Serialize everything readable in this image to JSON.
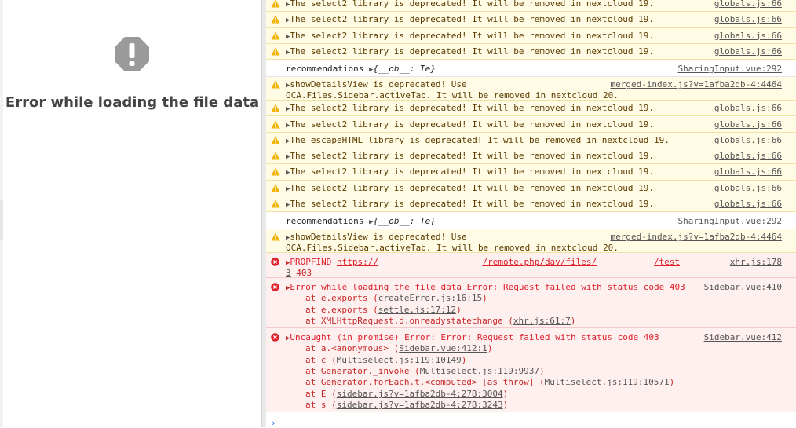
{
  "left": {
    "error_title": "Error while loading the file data"
  },
  "console": {
    "rows": [
      {
        "type": "warn",
        "msg": "The select2 library is deprecated! It will be removed in nextcloud 19.",
        "src": "globals.js:66"
      },
      {
        "type": "warn",
        "msg": "The select2 library is deprecated! It will be removed in nextcloud 19.",
        "src": "globals.js:66"
      },
      {
        "type": "warn",
        "msg": "The select2 library is deprecated! It will be removed in nextcloud 19.",
        "src": "globals.js:66"
      },
      {
        "type": "warn",
        "msg": "The select2 library is deprecated! It will be removed in nextcloud 19.",
        "src": "globals.js:66"
      },
      {
        "type": "log",
        "prefix": "recommendations",
        "obj": "{__ob__: Te}",
        "src": "SharingInput.vue:292"
      },
      {
        "type": "warn",
        "msg": "showDetailsView is deprecated! Use",
        "msg2": "OCA.Files.Sidebar.activeTab. It will be removed in nextcloud 20.",
        "src": "merged-index.js?v=1afba2db-4:4464"
      },
      {
        "type": "warn",
        "msg": "The select2 library is deprecated! It will be removed in nextcloud 19.",
        "src": "globals.js:66"
      },
      {
        "type": "warn",
        "msg": "The select2 library is deprecated! It will be removed in nextcloud 19.",
        "src": "globals.js:66"
      },
      {
        "type": "warn",
        "msg": "The escapeHTML library is deprecated! It will be removed in nextcloud 19.",
        "src": "globals.js:66"
      },
      {
        "type": "warn",
        "msg": "The select2 library is deprecated! It will be removed in nextcloud 19.",
        "src": "globals.js:66"
      },
      {
        "type": "warn",
        "msg": "The select2 library is deprecated! It will be removed in nextcloud 19.",
        "src": "globals.js:66"
      },
      {
        "type": "warn",
        "msg": "The select2 library is deprecated! It will be removed in nextcloud 19.",
        "src": "globals.js:66"
      },
      {
        "type": "warn",
        "msg": "The select2 library is deprecated! It will be removed in nextcloud 19.",
        "src": "globals.js:66"
      },
      {
        "type": "log",
        "prefix": "recommendations",
        "obj": "{__ob__: Te}",
        "src": "SharingInput.vue:292"
      },
      {
        "type": "warn",
        "msg": "showDetailsView is deprecated! Use",
        "msg2": "OCA.Files.Sidebar.activeTab. It will be removed in nextcloud 20.",
        "src": "merged-index.js?v=1afba2db-4:4464"
      }
    ],
    "propfind": {
      "method": "PROPFIND",
      "url_start": "https://",
      "url_mid": "/remote.php/dav/files/",
      "url_end": "/test",
      "src": "xhr.js:178",
      "src_cont": "3",
      "status": "403"
    },
    "error1": {
      "msg": "Error while loading the file data Error: Request failed with status code 403",
      "src": "Sidebar.vue:410",
      "stack": [
        {
          "at": "at e.exports (",
          "link": "createError.js:16:15",
          "end": ")"
        },
        {
          "at": "at e.exports (",
          "link": "settle.js:17:12",
          "end": ")"
        },
        {
          "at": "at XMLHttpRequest.d.onreadystatechange (",
          "link": "xhr.js:61:7",
          "end": ")"
        }
      ]
    },
    "error2": {
      "msg": "Uncaught (in promise) Error: Error: Request failed with status code 403",
      "src": "Sidebar.vue:412",
      "stack": [
        {
          "at": "at a.<anonymous> (",
          "link": "Sidebar.vue:412:1",
          "end": ")"
        },
        {
          "at": "at c (",
          "link": "Multiselect.js:119:10149",
          "end": ")"
        },
        {
          "at": "at Generator._invoke (",
          "link": "Multiselect.js:119:9937",
          "end": ")"
        },
        {
          "at": "at Generator.forEach.t.<computed> [as throw] (",
          "link": "Multiselect.js:119:10571",
          "end": ")"
        },
        {
          "at": "at E (",
          "link": "sidebar.js?v=1afba2db-4:278:3004",
          "end": ")"
        },
        {
          "at": "at s (",
          "link": "sidebar.js?v=1afba2db-4:278:3243",
          "end": ")"
        }
      ]
    },
    "prompt": "›"
  },
  "colors": {
    "warn_bg": "#fffbe5",
    "warn_icon": "#f2b400",
    "error_red": "#e0202a",
    "error_bg": "#fff0f0"
  }
}
